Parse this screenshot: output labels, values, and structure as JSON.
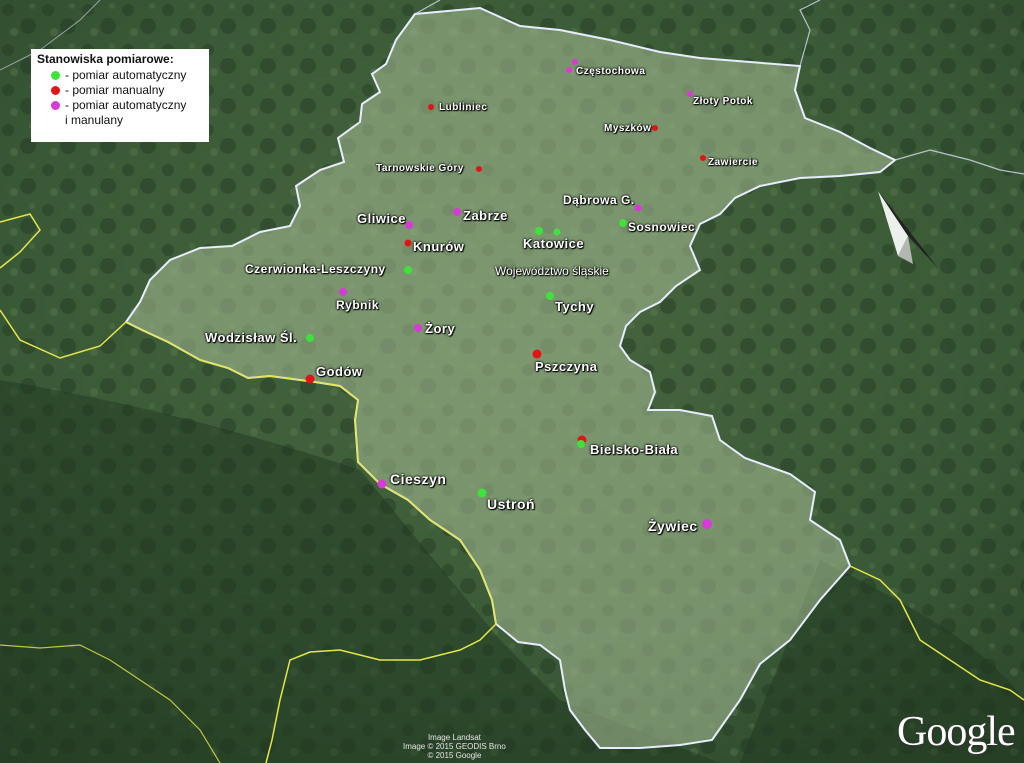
{
  "legend": {
    "title": "Stanowiska pomiarowe:",
    "items": [
      {
        "type": "auto",
        "label": "- pomiar automatyczny",
        "color": "#3ee23b"
      },
      {
        "type": "manual",
        "label": "- pomiar manualny",
        "color": "#e01616"
      },
      {
        "type": "both",
        "label": "- pomiar automatyczny\ni manulany",
        "color": "#d83ad8"
      }
    ]
  },
  "region_label": "Województwo śląskie",
  "colors": {
    "auto": "#3ee23b",
    "manual": "#e01616",
    "both": "#d83ad8",
    "region_fill": "#a9bf98",
    "region_border": "#e8ecff",
    "country_border": "#e6e64a",
    "forest": "#2f4a2f"
  },
  "stations": [
    {
      "name": "Częstochowa",
      "kind": "both"
    },
    {
      "name": "Lubliniec",
      "kind": "manual"
    },
    {
      "name": "Złoty Potok",
      "kind": "both"
    },
    {
      "name": "Myszków",
      "kind": "manual"
    },
    {
      "name": "Zawiercie",
      "kind": "manual"
    },
    {
      "name": "Tarnowskie Góry",
      "kind": "manual"
    },
    {
      "name": "Dąbrowa G.",
      "kind": "both"
    },
    {
      "name": "Gliwice",
      "kind": "both"
    },
    {
      "name": "Zabrze",
      "kind": "both"
    },
    {
      "name": "Sosnowiec",
      "kind": "auto"
    },
    {
      "name": "Knurów",
      "kind": "manual"
    },
    {
      "name": "Katowice",
      "kind": "auto"
    },
    {
      "name": "Czerwionka-Leszczyny",
      "kind": "auto"
    },
    {
      "name": "Rybnik",
      "kind": "both"
    },
    {
      "name": "Tychy",
      "kind": "auto"
    },
    {
      "name": "Żory",
      "kind": "both"
    },
    {
      "name": "Wodzisław Śl.",
      "kind": "auto"
    },
    {
      "name": "Pszczyna",
      "kind": "manual"
    },
    {
      "name": "Godów",
      "kind": "manual"
    },
    {
      "name": "Bielsko-Biała",
      "kind": "manual"
    },
    {
      "name": "Cieszyn",
      "kind": "both"
    },
    {
      "name": "Ustroń",
      "kind": "auto"
    },
    {
      "name": "Żywiec",
      "kind": "both"
    }
  ],
  "credits": [
    "Image Landsat",
    "Image © 2015 GEODIS Brno",
    "© 2015 Google"
  ],
  "logo": "Google"
}
